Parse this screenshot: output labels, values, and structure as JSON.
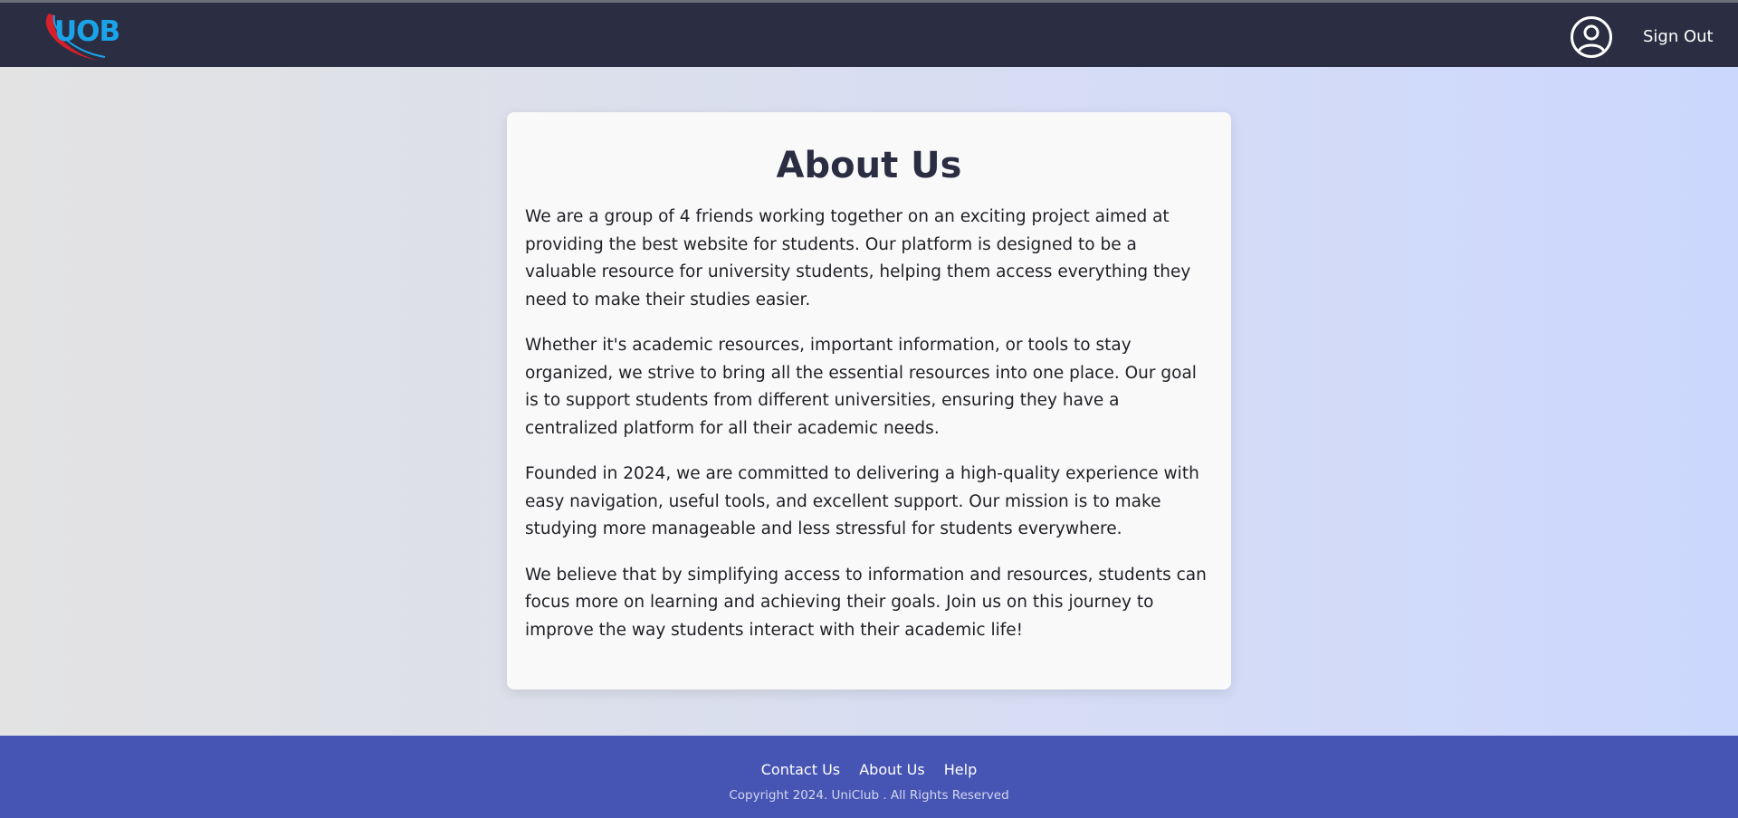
{
  "header": {
    "logo_text": "UOB",
    "account_icon": "user-circle-icon",
    "sign_out_label": "Sign Out"
  },
  "main": {
    "title": "About Us",
    "paragraphs": [
      "We are a group of 4 friends working together on an exciting project aimed at providing the best website for students. Our platform is designed to be a valuable resource for university students, helping them access everything they need to make their studies easier.",
      "Whether it's academic resources, important information, or tools to stay organized, we strive to bring all the essential resources into one place. Our goal is to support students from different universities, ensuring they have a centralized platform for all their academic needs.",
      "Founded in 2024, we are committed to delivering a high-quality experience with easy navigation, useful tools, and excellent support. Our mission is to make studying more manageable and less stressful for students everywhere.",
      "We believe that by simplifying access to information and resources, students can focus more on learning and achieving their goals. Join us on this journey to improve the way students interact with their academic life!"
    ]
  },
  "footer": {
    "links": [
      "Contact Us",
      "About Us",
      "Help"
    ],
    "copyright": "Copyright 2024. UniClub . All Rights Reserved"
  },
  "colors": {
    "header_bg": "#2b2e42",
    "footer_bg": "#4655b4",
    "logo_blue": "#1aa3e8",
    "logo_red": "#d6202c",
    "card_bg": "#f9f9fa"
  }
}
